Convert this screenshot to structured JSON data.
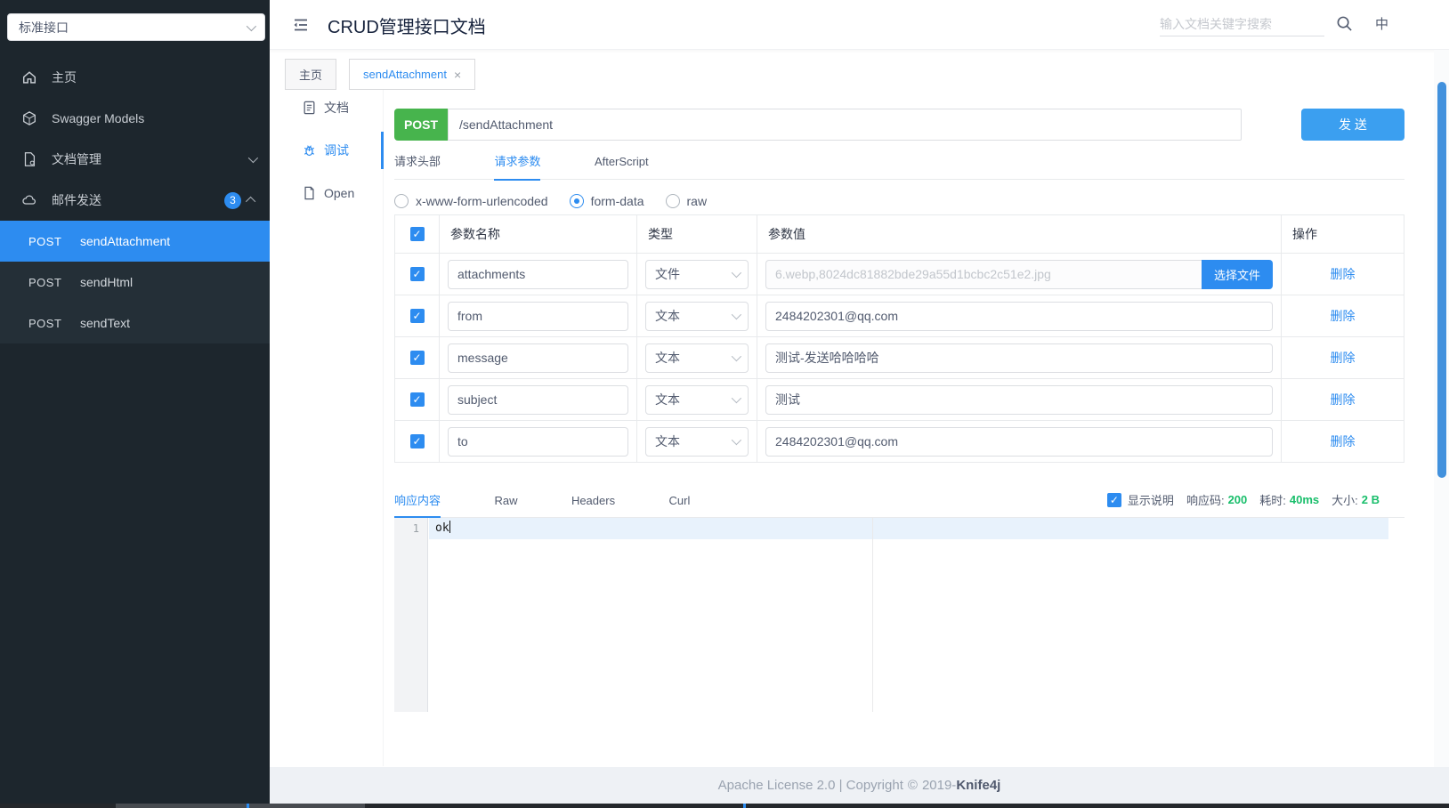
{
  "sidebar": {
    "group_select": {
      "value": "标准接口"
    },
    "items": [
      {
        "label": "主页"
      },
      {
        "label": "Swagger Models"
      },
      {
        "label": "文档管理"
      },
      {
        "label": "邮件发送",
        "badge": "3"
      }
    ],
    "submenu": [
      {
        "method": "POST",
        "name": "sendAttachment"
      },
      {
        "method": "POST",
        "name": "sendHtml"
      },
      {
        "method": "POST",
        "name": "sendText"
      }
    ]
  },
  "header": {
    "title": "CRUD管理接口文档",
    "search_placeholder": "输入文档关键字搜索",
    "lang": "中"
  },
  "doc_tabs": [
    {
      "label": "主页"
    },
    {
      "label": "sendAttachment"
    }
  ],
  "doc_nav": [
    {
      "label": "文档"
    },
    {
      "label": "调试"
    },
    {
      "label": "Open"
    }
  ],
  "request": {
    "method": "POST",
    "url": "/sendAttachment",
    "send_label": "发 送",
    "tabs": [
      {
        "label": "请求头部"
      },
      {
        "label": "请求参数"
      },
      {
        "label": "AfterScript"
      }
    ],
    "body_types": [
      {
        "label": "x-www-form-urlencoded"
      },
      {
        "label": "form-data"
      },
      {
        "label": "raw"
      }
    ],
    "table": {
      "headers": {
        "name": "参数名称",
        "type": "类型",
        "value": "参数值",
        "action": "操作"
      },
      "rows": [
        {
          "name": "attachments",
          "type": "文件",
          "value": "6.webp,8024dc81882bde29a55d1bcbc2c51e2.jpg",
          "file_button": "选择文件",
          "action": "删除"
        },
        {
          "name": "from",
          "type": "文本",
          "value": "2484202301@qq.com",
          "action": "删除"
        },
        {
          "name": "message",
          "type": "文本",
          "value": "测试-发送哈哈哈哈",
          "action": "删除"
        },
        {
          "name": "subject",
          "type": "文本",
          "value": "测试",
          "action": "删除"
        },
        {
          "name": "to",
          "type": "文本",
          "value": "2484202301@qq.com",
          "action": "删除"
        }
      ]
    }
  },
  "response": {
    "tabs": [
      {
        "label": "响应内容"
      },
      {
        "label": "Raw"
      },
      {
        "label": "Headers"
      },
      {
        "label": "Curl"
      }
    ],
    "show_desc_label": "显示说明",
    "status": {
      "code_label": "响应码:",
      "code_value": "200",
      "time_label": "耗时:",
      "time_value": "40ms",
      "size_label": "大小:",
      "size_value": "2 B"
    },
    "editor": {
      "line_number": "1",
      "content": "ok"
    }
  },
  "footer": {
    "license": "Apache License 2.0 | Copyright",
    "year": "2019-",
    "brand": "Knife4j"
  },
  "colors": {
    "accent_blue": "#2d8cf0",
    "post_green": "#47b44d",
    "success_green": "#19be6b",
    "send_blue": "#3b9ff0",
    "scrollbar_blue": "#4291dd",
    "sidebar_dark": "#1d262d"
  }
}
